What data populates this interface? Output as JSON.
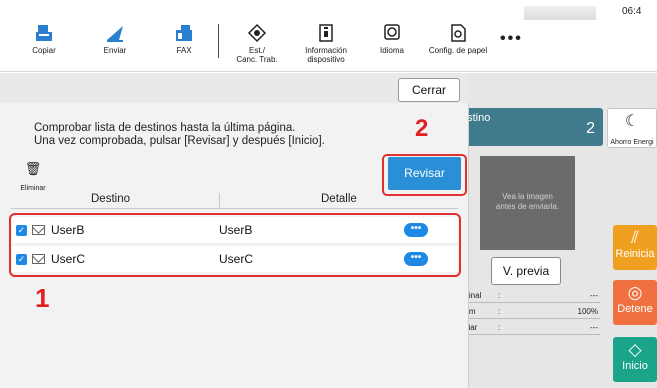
{
  "topbar": {
    "buttons": [
      {
        "label": "Copiar",
        "icon": "copy-icon"
      },
      {
        "label": "Enviar",
        "icon": "send-icon"
      },
      {
        "label": "FAX",
        "icon": "fax-icon"
      },
      {
        "label": "Est./\nCanc. Trab.",
        "icon": "job-status-icon"
      },
      {
        "label": "Información\ndispositivo",
        "icon": "device-info-icon"
      },
      {
        "label": "Idioma",
        "icon": "language-icon"
      },
      {
        "label": "Config. de papel",
        "icon": "paper-config-icon"
      }
    ],
    "more_label": "•••",
    "clock": "06:4"
  },
  "background": {
    "destination_label": "estino",
    "destination_count": "2",
    "energy_saver_label": "Ahorro Energi",
    "preview_text": "Vea la imagen\nantes de enviarla.",
    "preview_button": "V. previa",
    "info": [
      {
        "key": "riginal",
        "value": "---"
      },
      {
        "key": "oom",
        "value": "100%"
      },
      {
        "key": "nviar",
        "value": "---"
      }
    ],
    "reset_label": "Reinicia",
    "stop_label": "Detene",
    "start_label": "Inicio"
  },
  "dialog": {
    "close_label": "Cerrar",
    "message": "Comprobar lista de destinos hasta la última página.\nUna vez comprobada, pulsar [Revisar] y después [Inicio].",
    "check_button": "Revisar",
    "delete_label": "Eliminar",
    "columns": [
      "Destino",
      "Detalle"
    ],
    "rows": [
      {
        "destination": "UserB",
        "detail": "UserB",
        "checked": true
      },
      {
        "destination": "UserC",
        "detail": "UserC",
        "checked": true
      }
    ],
    "step_markers": [
      "1",
      "2"
    ]
  },
  "colors": {
    "accent_blue": "#2a8fd6",
    "callout_red": "#e02020",
    "reset_orange": "#f0a020",
    "stop_orange": "#f07040",
    "start_green": "#1aa58a",
    "destination_teal": "#3f7b8c"
  }
}
